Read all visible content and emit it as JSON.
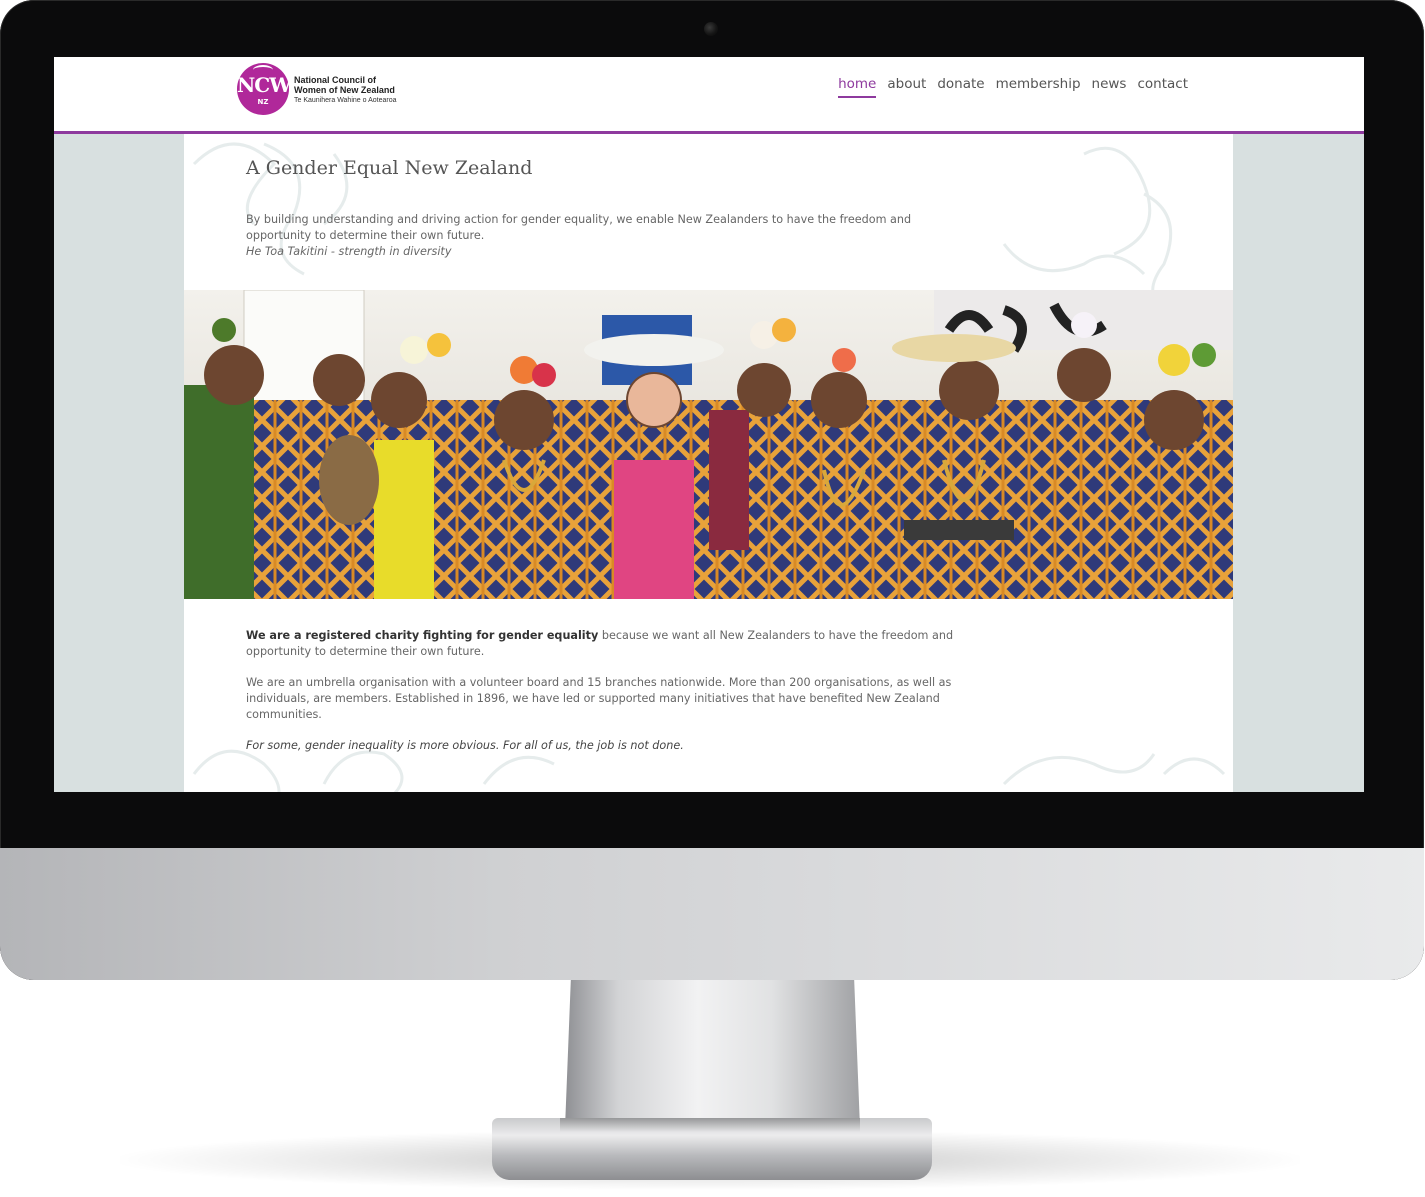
{
  "brand": {
    "monogram": "NCW",
    "badge_country": "NZ",
    "name_line1": "National Council of",
    "name_line2": "Women of New Zealand",
    "maori_name": "Te Kaunihera Wahine o Aotearoa",
    "accent_color": "#8e3a9e",
    "logo_color": "#b0289a"
  },
  "nav": [
    {
      "label": "home",
      "active": true
    },
    {
      "label": "about",
      "active": false
    },
    {
      "label": "donate",
      "active": false
    },
    {
      "label": "membership",
      "active": false
    },
    {
      "label": "news",
      "active": false
    },
    {
      "label": "contact",
      "active": false
    }
  ],
  "hero_section": {
    "title": "A Gender Equal New Zealand",
    "intro": "By building understanding and driving action for gender equality, we enable New Zealanders to have the freedom and opportunity to determine their own future.",
    "motto": "He Toa Takitini - strength in diversity"
  },
  "body": {
    "p1_strong": "We are a registered charity fighting for gender equality",
    "p1_rest": " because we want all New Zealanders to have the freedom and opportunity to determine their own future.",
    "p2": "We are an umbrella organisation with a volunteer board and 15 branches nationwide. More than 200 organisations, as well as individuals, are members. Established in 1896, we have led or supported many initiatives that have benefited New Zealand communities.",
    "p3": "For some, gender inequality is more obvious. For all of us, the job is not done."
  },
  "icons": {
    "camera": "webcam-icon"
  }
}
